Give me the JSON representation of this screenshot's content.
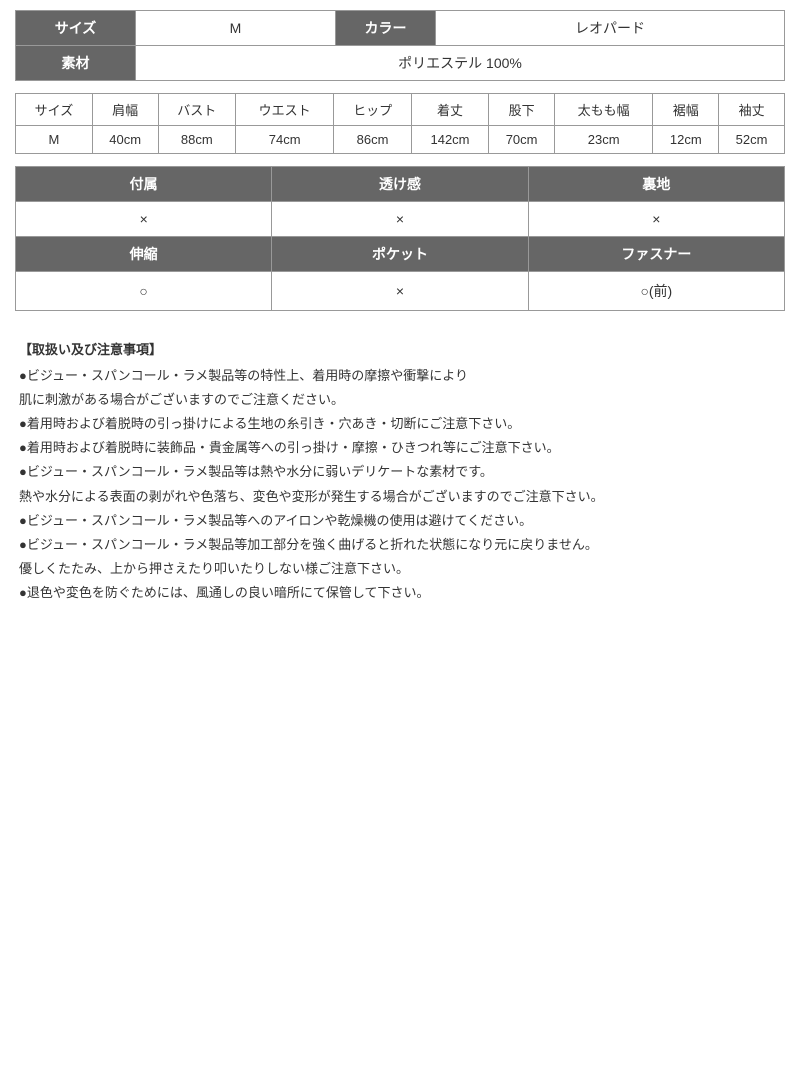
{
  "topInfo": {
    "sizeLabel": "サイズ",
    "sizeValue": "M",
    "colorLabel": "カラー",
    "colorValue": "レオパード",
    "materialLabel": "素材",
    "materialValue": "ポリエステル 100%"
  },
  "sizeChart": {
    "headers": [
      "サイズ",
      "肩幅",
      "バスト",
      "ウエスト",
      "ヒップ",
      "着丈",
      "股下",
      "太もも幅",
      "裾幅",
      "袖丈"
    ],
    "row": [
      "M",
      "40cm",
      "88cm",
      "74cm",
      "86cm",
      "142cm",
      "70cm",
      "23cm",
      "12cm",
      "52cm"
    ]
  },
  "props": {
    "row1": {
      "col1Label": "付属",
      "col2Label": "透け感",
      "col3Label": "裏地"
    },
    "row2": {
      "col1Value": "×",
      "col2Value": "×",
      "col3Value": "×"
    },
    "row3": {
      "col1Label": "伸縮",
      "col2Label": "ポケット",
      "col3Label": "ファスナー"
    },
    "row4": {
      "col1Value": "○",
      "col2Value": "×",
      "col3Value": "○(前)"
    }
  },
  "notes": {
    "title": "【取扱い及び注意事項】",
    "lines": [
      "●ビジュー・スパンコール・ラメ製品等の特性上、着用時の摩擦や衝撃により",
      "肌に刺激がある場合がございますのでご注意ください。",
      "●着用時および着脱時の引っ掛けによる生地の糸引き・穴あき・切断にご注意下さい。",
      "●着用時および着脱時に装飾品・貴金属等への引っ掛け・摩擦・ひきつれ等にご注意下さい。",
      "●ビジュー・スパンコール・ラメ製品等は熱や水分に弱いデリケートな素材です。",
      "熱や水分による表面の剥がれや色落ち、変色や変形が発生する場合がございますのでご注意下さい。",
      "●ビジュー・スパンコール・ラメ製品等へのアイロンや乾燥機の使用は避けてください。",
      "●ビジュー・スパンコール・ラメ製品等加工部分を強く曲げると折れた状態になり元に戻りません。",
      "優しくたたみ、上から押さえたり叩いたりしない様ご注意下さい。",
      "●退色や変色を防ぐためには、風通しの良い暗所にて保管して下さい。"
    ]
  }
}
